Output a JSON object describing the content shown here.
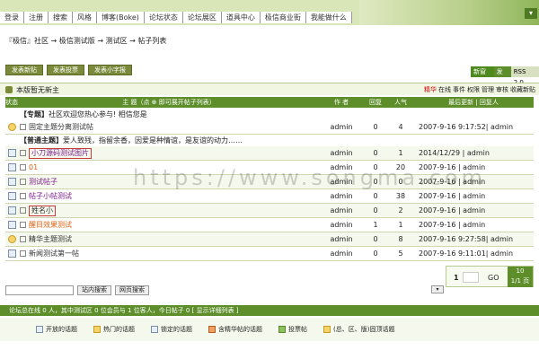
{
  "nav": [
    "登录",
    "注册",
    "搜索",
    "风格",
    "博客(Boke)",
    "论坛状态",
    "论坛展区",
    "道具中心",
    "极信商业街",
    "我能做什么"
  ],
  "breadcrumb": "『极信』社区 → 极信测试版 → 测试区 → 帖子列表",
  "actions": [
    "发表新贴",
    "发表投票",
    "发表小字报"
  ],
  "rss": [
    "新窗口",
    "发帖",
    "RSS 2.0"
  ],
  "notice": "本版暂无新主",
  "filters": [
    "精华",
    "在线",
    "事件",
    "权限",
    "管理",
    "审核",
    "收藏新贴"
  ],
  "columns": {
    "status": "状态",
    "topic": "主 题（点 ⊕ 即可展开帖子列表）",
    "author": "作 者",
    "replies": "回复",
    "views": "人气",
    "last": "最后更新 | 回复人"
  },
  "section_top": {
    "tag": "【专题】",
    "text": "社区欢迎您热心参与! 相信您是"
  },
  "section_normal": {
    "tag": "【普通主题】",
    "text": "爱人致残，指留余香，因爱是种情谊，是友谊的动力……"
  },
  "rows": [
    {
      "title": "固定主题分离测试帖",
      "author": "admin",
      "replies": "0",
      "views": "4",
      "last": "2007-9-16 9:17:52| admin",
      "style": "",
      "icon": "hot"
    },
    {
      "title": "小刀源码测试图片",
      "author": "admin",
      "replies": "0",
      "views": "1",
      "last": "2014/12/29 | admin",
      "style": "purple boxed",
      "icon": ""
    },
    {
      "title": "01",
      "author": "admin",
      "replies": "0",
      "views": "20",
      "last": "2007-9-16 | admin",
      "style": "orange",
      "icon": ""
    },
    {
      "title": "测试帖子",
      "author": "admin",
      "replies": "0",
      "views": "0",
      "last": "2007-9-16 | admin",
      "style": "purple",
      "icon": ""
    },
    {
      "title": "帖子小帖测试",
      "author": "admin",
      "replies": "0",
      "views": "38",
      "last": "2007-9-16 | admin",
      "style": "purple",
      "icon": ""
    },
    {
      "title": "姓名小",
      "author": "admin",
      "replies": "0",
      "views": "2",
      "last": "2007-9-16 | admin",
      "style": "boxed",
      "icon": ""
    },
    {
      "title": "醒目效果测试",
      "author": "admin",
      "replies": "1",
      "views": "1",
      "last": "2007-9-16 | admin",
      "style": "orange",
      "icon": ""
    },
    {
      "title": "精华主题测试",
      "author": "admin",
      "replies": "0",
      "views": "8",
      "last": "2007-9-16 9:27:58| admin",
      "style": "",
      "icon": "hot"
    },
    {
      "title": "新闻测试第一帖",
      "author": "admin",
      "replies": "0",
      "views": "5",
      "last": "2007-9-16 9:11:01| admin",
      "style": "",
      "icon": ""
    }
  ],
  "pager": {
    "current": "1",
    "go": "GO",
    "total_top": "10",
    "total_bottom": "1/1 页"
  },
  "search": {
    "btn1": "站内搜索",
    "btn2": "网页搜索"
  },
  "online": "论坛总在线 0 人，其中测试区 0 位会员与 1 位客人，今日帖子 0 [ 显示详细列表 ]",
  "legend": [
    "开放的话题",
    "热门的话题",
    "锁定的话题",
    "含精华帖的话题",
    "投票帖",
    "(总、区、版)固顶话题"
  ],
  "watermark": "https://www.songma.com"
}
